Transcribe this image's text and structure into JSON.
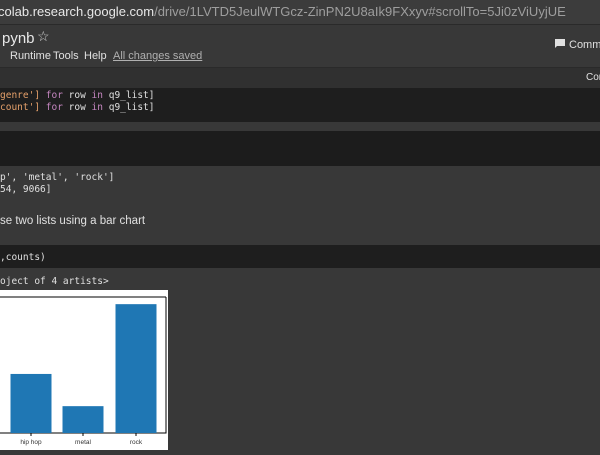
{
  "browser": {
    "url_host": "colab.research.google.com",
    "url_path": "/drive/1LVTD5JeulWTGcz-ZinPN2U8aIk9FXxyv#scrollTo=5Ji0zViUyjUE"
  },
  "header": {
    "title": "pynb",
    "menu": [
      "Runtime",
      "Tools",
      "Help"
    ],
    "save_status": "All changes saved",
    "comment_label": "Comme",
    "connect_label": "Con"
  },
  "cells": {
    "code1": {
      "line1": [
        "genre'] ",
        "for",
        " row ",
        "in",
        " q9_list]"
      ],
      "line2": [
        "count'] ",
        "for",
        " row ",
        "in",
        " q9_list]"
      ]
    },
    "output1": {
      "line1": "p', 'metal', 'rock']",
      "line2": "54, 9066]"
    },
    "text1": "se two lists using a bar chart",
    "code2": ",counts)",
    "output2": "oject of 4 artists>"
  },
  "chart_data": {
    "type": "bar",
    "categories": [
      "hip hop",
      "metal",
      "rock"
    ],
    "values": [
      3300,
      1500,
      7200
    ],
    "ylim": [
      0,
      7600
    ],
    "colors": {
      "bar": "#1f77b4"
    }
  }
}
